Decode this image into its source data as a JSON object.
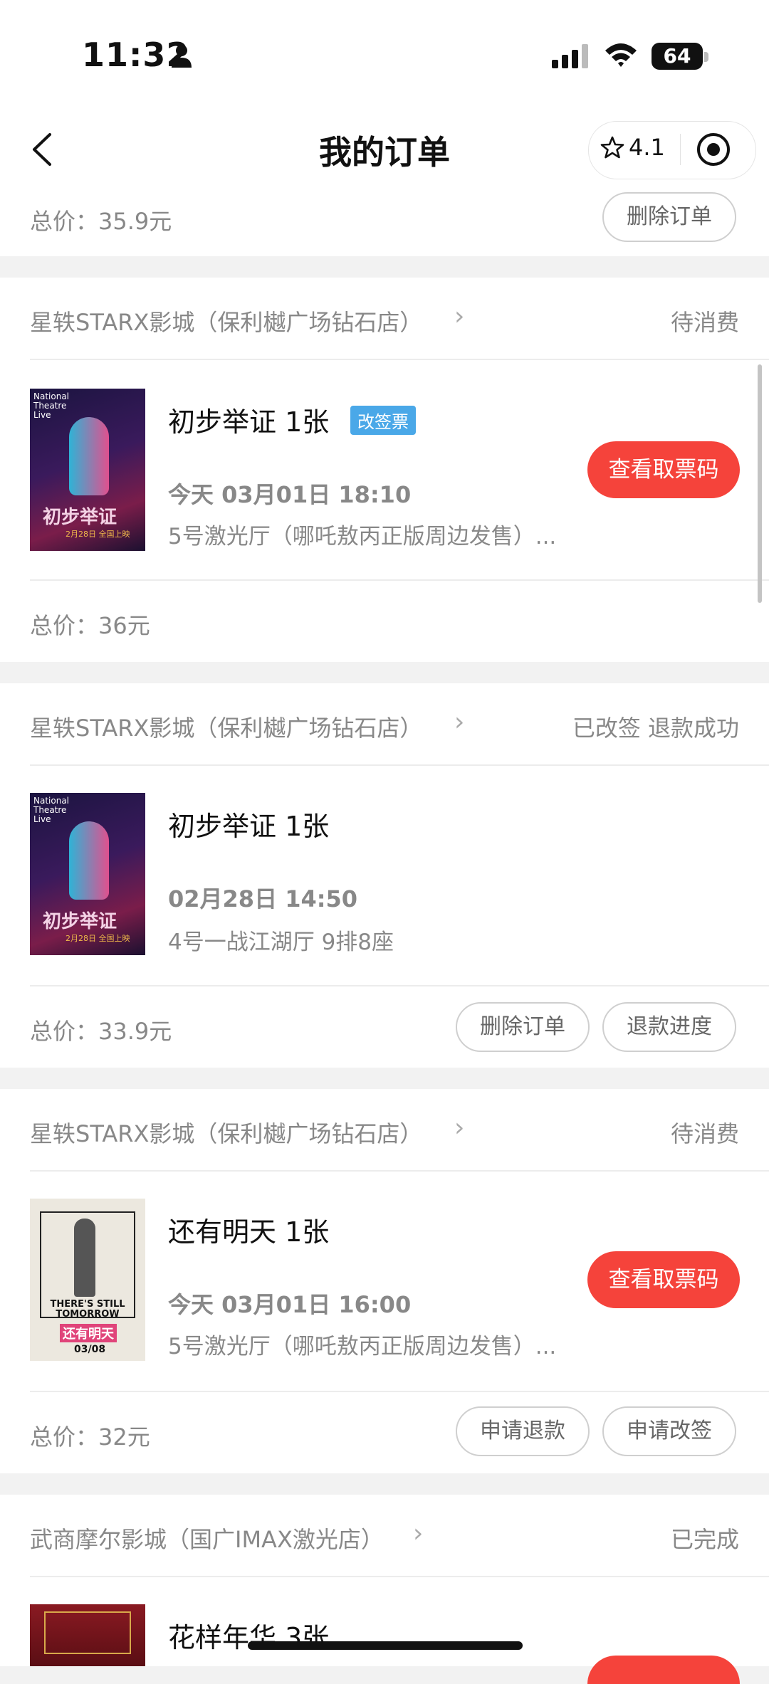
{
  "status_bar": {
    "time": "11:32",
    "battery": "64"
  },
  "nav": {
    "title": "我的订单",
    "rating": "4.1"
  },
  "top_partial": {
    "price": "总价：35.9元",
    "buttons": [
      "删除订单"
    ]
  },
  "orders": [
    {
      "cinema": "星轶STARX影城（保利樾广场钻石店）",
      "status": "待消费",
      "movie": "初步举证 1张",
      "tag": "改签票",
      "showtime": "今天 03月01日 18:10",
      "hall": "5号激光厅（哪吒敖丙正版周边发售）...",
      "price": "总价：36元",
      "primary_button": "查看取票码",
      "buttons": [],
      "poster": {
        "brand": "National Theatre Live",
        "title": "初步举证",
        "sub": "2月28日 全国上映"
      }
    },
    {
      "cinema": "星轶STARX影城（保利樾广场钻石店）",
      "status": "已改签 退款成功",
      "movie": "初步举证 1张",
      "tag": "",
      "showtime": "02月28日 14:50",
      "hall": "4号一战江湖厅 9排8座",
      "price": "总价：33.9元",
      "primary_button": "",
      "buttons": [
        "删除订单",
        "退款进度"
      ],
      "poster": {
        "brand": "National Theatre Live",
        "title": "初步举证",
        "sub": "2月28日 全国上映"
      }
    },
    {
      "cinema": "星轶STARX影城（保利樾广场钻石店）",
      "status": "待消费",
      "movie": "还有明天 1张",
      "tag": "",
      "showtime": "今天 03月01日 16:00",
      "hall": "5号激光厅（哪吒敖丙正版周边发售）...",
      "price": "总价：32元",
      "primary_button": "查看取票码",
      "buttons": [
        "申请退款",
        "申请改签"
      ],
      "poster": {
        "title_en": "THERE'S STILL TOMORROW",
        "title_cn": "还有明天",
        "date": "03/08"
      }
    },
    {
      "cinema": "武商摩尔影城（国广IMAX激光店）",
      "status": "已完成",
      "movie": "花样年华 3张"
    }
  ],
  "colors": {
    "accent_red": "#f5433b",
    "tag_blue": "#4aa8e8",
    "background": "#f2f2f2"
  }
}
